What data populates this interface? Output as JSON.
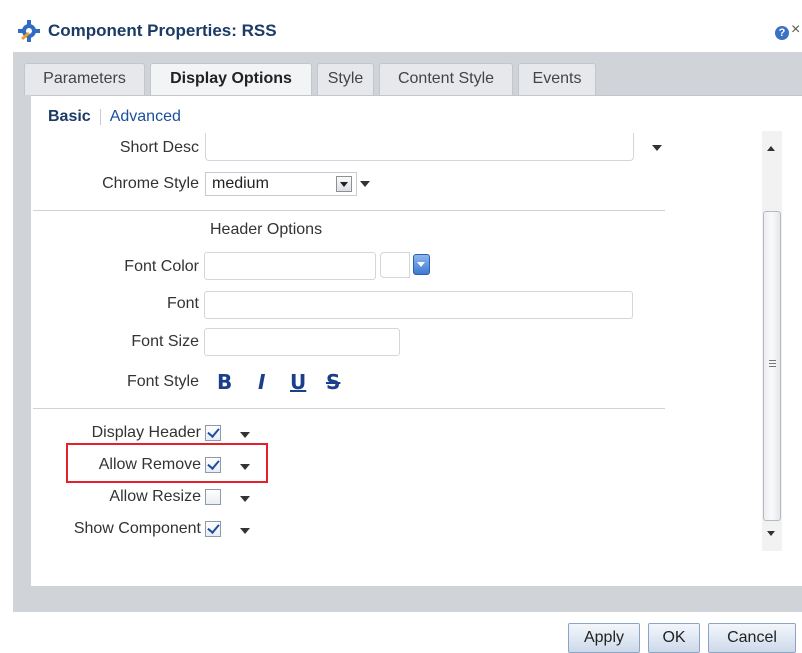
{
  "dialog": {
    "title": "Component Properties: RSS",
    "help_icon": "help-icon",
    "help_symbol": "?",
    "close_icon": "close-icon",
    "close_symbol": "×"
  },
  "tabs": [
    {
      "label": "Parameters",
      "active": false
    },
    {
      "label": "Display Options",
      "active": true
    },
    {
      "label": "Style",
      "active": false
    },
    {
      "label": "Content Style",
      "active": false
    },
    {
      "label": "Events",
      "active": false
    }
  ],
  "subnav": {
    "basic": "Basic",
    "advanced": "Advanced"
  },
  "fields": {
    "short_desc_label": "Short Desc",
    "short_desc_value": "",
    "chrome_style_label": "Chrome Style",
    "chrome_style_value": "medium",
    "header_options_title": "Header Options",
    "font_color_label": "Font Color",
    "font_color_value": "",
    "font_label": "Font",
    "font_value": "",
    "font_size_label": "Font Size",
    "font_size_value": "",
    "font_style_label": "Font Style",
    "font_style_bold": "B",
    "font_style_italic": "I",
    "font_style_underline": "U",
    "font_style_strike": "S"
  },
  "checkboxes": [
    {
      "label": "Display Header",
      "checked": true
    },
    {
      "label": "Allow Remove",
      "checked": true
    },
    {
      "label": "Allow Resize",
      "checked": false
    },
    {
      "label": "Show Component",
      "checked": true
    }
  ],
  "footer": {
    "apply": "Apply",
    "ok": "OK",
    "cancel": "Cancel"
  },
  "colors": {
    "accent": "#1b3a66",
    "highlight_border": "#e4212b",
    "panel_bg": "#d0d3d8"
  }
}
